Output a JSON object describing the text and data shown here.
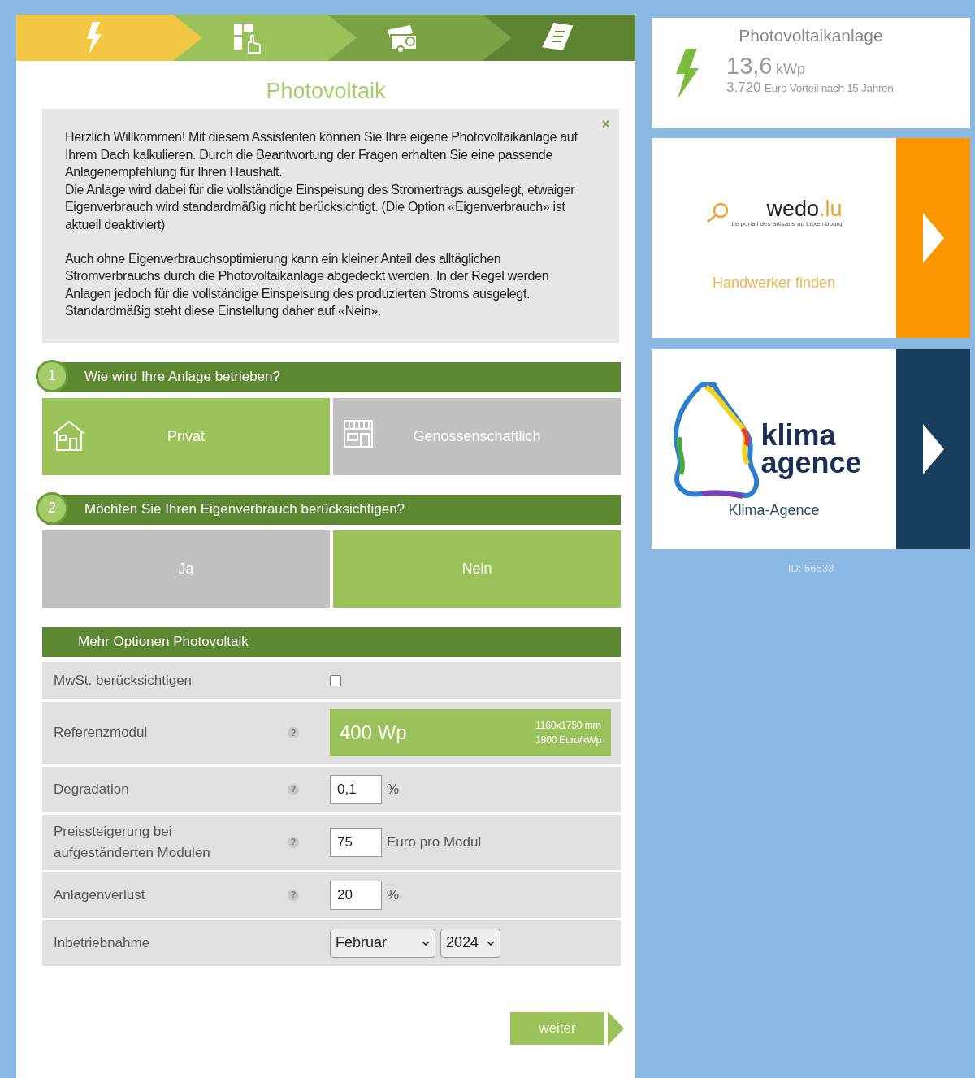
{
  "steps": [
    {
      "kind": "bolt",
      "color": "#f2c744"
    },
    {
      "kind": "panel",
      "color": "#9bc25a"
    },
    {
      "kind": "photos",
      "color": "#7ba345"
    },
    {
      "kind": "document",
      "color": "#5e8331"
    }
  ],
  "title": "Photovoltaik",
  "info": {
    "close": "×",
    "paragraphs": [
      [
        "Herzlich Willkommen! Mit diesem Assistenten können Sie Ihre eigene Photovoltaikanlage auf Ihrem Dach kalkulieren. Durch die Beantwortung der Fragen erhalten Sie eine passende Anlagenempfehlung für Ihren Haushalt.",
        "Die Anlage wird dabei für die vollständige Einspeisung des Stromertrags ausgelegt, etwaiger Eigenverbrauch wird standardmäßig nicht berücksichtigt. (Die Option «Eigenverbrauch» ist aktuell deaktiviert)"
      ],
      [
        "Auch ohne Eigenverbrauchsoptimierung kann ein kleiner Anteil des alltäglichen Stromverbrauchs durch die Photovoltaikanlage abgedeckt werden. In der Regel werden Anlagen jedoch für die vollständige Einspeisung des produzierten Stroms ausgelegt. Standardmäßig steht diese Einstellung daher auf «Nein»."
      ]
    ]
  },
  "questions": [
    {
      "number": "1",
      "text": "Wie wird Ihre Anlage betrieben?",
      "options": [
        {
          "label": "Privat",
          "kind": "house",
          "selected": true
        },
        {
          "label": "Genossenschaftlich",
          "kind": "shop",
          "selected": false
        }
      ]
    },
    {
      "number": "2",
      "text": "Möchten Sie Ihren Eigenverbrauch berücksichtigen?",
      "options": [
        {
          "label": "Ja",
          "selected": false
        },
        {
          "label": "Nein",
          "selected": true
        }
      ]
    }
  ],
  "more_options": {
    "title": "Mehr Optionen Photovoltaik",
    "rows": [
      {
        "kind": "checkbox",
        "label": "MwSt. berücksichtigen",
        "checked": false
      },
      {
        "kind": "module",
        "label": "Referenzmodul",
        "help": "?",
        "value": "400 Wp",
        "size": "1160x1750 mm",
        "price": "1800 Euro/kWp"
      },
      {
        "kind": "input",
        "label": "Degradation",
        "help": "?",
        "value": "0,1",
        "unit": "%"
      },
      {
        "kind": "input",
        "label": "Preissteigerung bei aufgeständerten Modulen",
        "help": "?",
        "value": "75",
        "unit": "Euro pro Modul"
      },
      {
        "kind": "input",
        "label": "Anlagenverlust",
        "help": "?",
        "value": "20",
        "unit": "%"
      },
      {
        "kind": "select",
        "label": "Inbetriebnahme",
        "selects": [
          "Februar",
          "2024"
        ]
      }
    ]
  },
  "next_button": "weiter",
  "summary": {
    "title": "Photovoltaikanlage",
    "value": "13,6",
    "unit": "kWp",
    "savings_value": "3.720",
    "savings_text": "Euro Vorteil nach 15 Jahren"
  },
  "promos": [
    {
      "kind": "wedo",
      "logo": "wedo",
      "logo_suffix": ".lu",
      "tagline": "Le portail des artisans au Luxembourg",
      "caption": "Handwerker finden",
      "color": "#fb9500"
    },
    {
      "kind": "klima",
      "logo_lines": [
        "klima",
        "agence"
      ],
      "caption": "Klima-Agence",
      "color": "#183e5d"
    }
  ],
  "footer_id": "ID: 56533"
}
